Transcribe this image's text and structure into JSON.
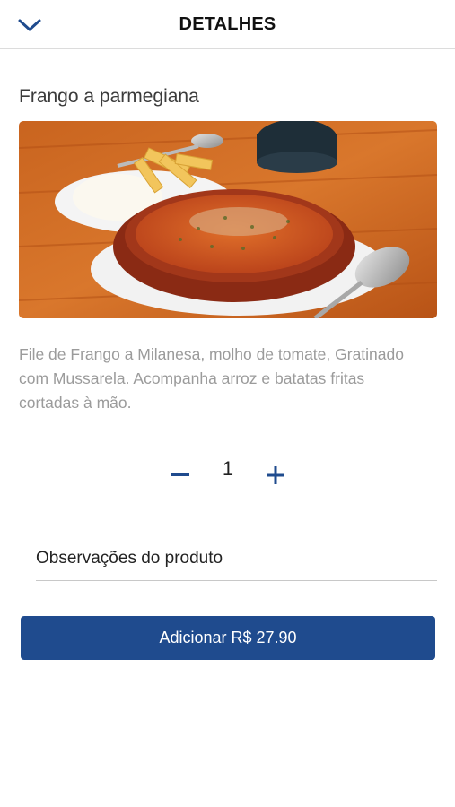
{
  "header": {
    "title": "DETALHES",
    "back_icon": "chevron-down-icon",
    "accent_color": "#1f4b8e"
  },
  "product": {
    "name": "Frango a parmegiana",
    "image_description_icon": "food-photo",
    "description": "File de Frango a Milanesa, molho de tomate, Gratinado com Mussarela. Acompanha arroz e batatas fritas cortadas à mão."
  },
  "quantity": {
    "value": "1",
    "minus_icon": "minus-icon",
    "plus_icon": "plus-icon"
  },
  "notes": {
    "placeholder": "Observações do produto",
    "value": ""
  },
  "add_button": {
    "label": "Adicionar R$ 27.90",
    "color": "#1f4b8e"
  }
}
